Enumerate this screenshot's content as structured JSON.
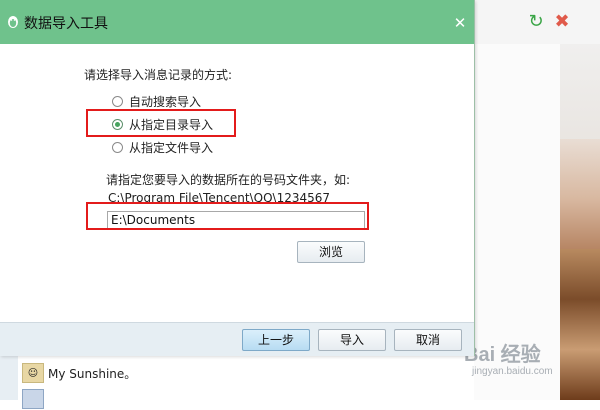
{
  "dialog": {
    "title": "数据导入工具",
    "prompt": "请选择导入消息记录的方式:",
    "options": [
      {
        "label": "自动搜索导入",
        "selected": false
      },
      {
        "label": "从指定目录导入",
        "selected": true
      },
      {
        "label": "从指定文件导入",
        "selected": false
      }
    ],
    "folder_prompt": "请指定您要导入的数据所在的号码文件夹，如:",
    "example_path": "C:\\Program File\\Tencent\\QQ\\1234567",
    "path_value": "E:\\Documents",
    "browse_label": "浏览",
    "back_label": "上一步",
    "import_label": "导入",
    "cancel_label": "取消"
  },
  "contacts": [
    {
      "name": "My Sunshine。"
    }
  ],
  "watermark": {
    "brand": "Bai 经验",
    "url": "jingyan.baidu.com"
  },
  "colors": {
    "titlebar": "#6fc28c",
    "highlight": "#e31b1b",
    "footer": "#e6eef3"
  }
}
